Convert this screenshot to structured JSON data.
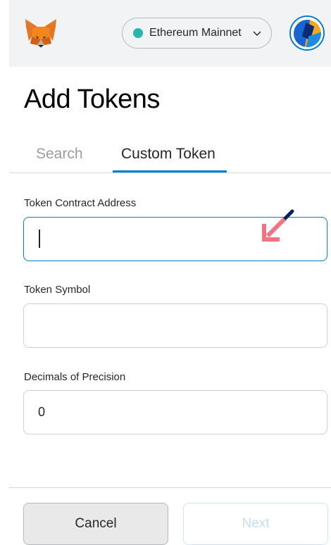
{
  "header": {
    "network": {
      "label": "Ethereum Mainnet",
      "status_color": "#29b6af"
    }
  },
  "page": {
    "title": "Add Tokens"
  },
  "tabs": [
    {
      "label": "Search",
      "active": false
    },
    {
      "label": "Custom Token",
      "active": true
    }
  ],
  "form": {
    "contract_address": {
      "label": "Token Contract Address",
      "value": ""
    },
    "symbol": {
      "label": "Token Symbol",
      "value": ""
    },
    "decimals": {
      "label": "Decimals of Precision",
      "value": "0"
    }
  },
  "footer": {
    "cancel_label": "Cancel",
    "next_label": "Next"
  },
  "colors": {
    "accent": "#037dd6",
    "annotation_arrow": "#f27382"
  }
}
